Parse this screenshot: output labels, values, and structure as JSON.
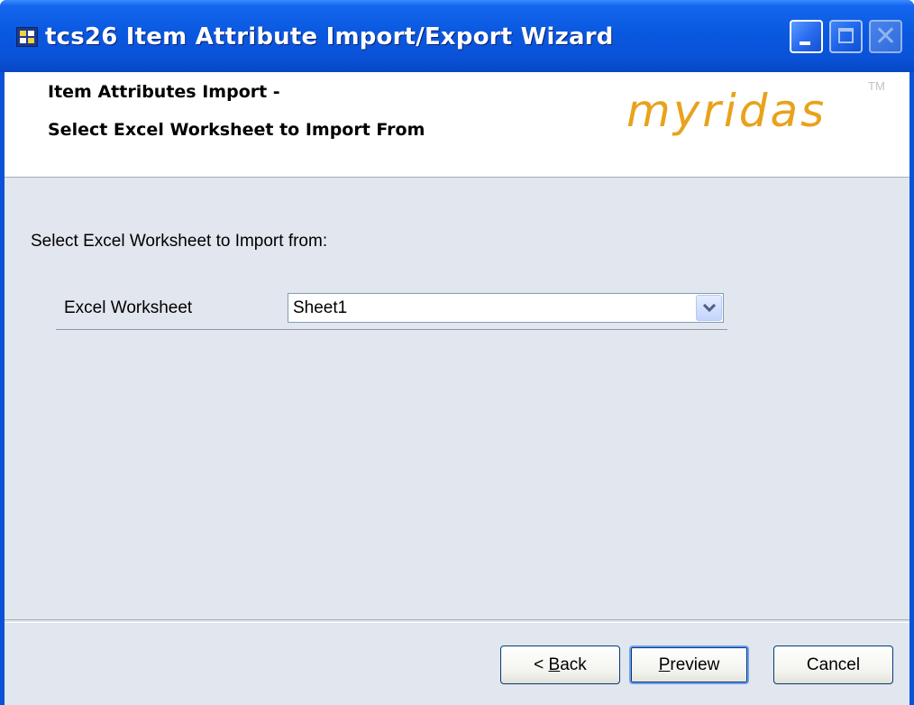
{
  "window": {
    "title": "tcs26 Item Attribute Import/Export Wizard",
    "app_icon": "app-icon",
    "controls": {
      "minimize_icon": "minimize-icon",
      "maximize_icon": "maximize-icon",
      "close_icon": "close-icon",
      "close_glyph": "✕"
    }
  },
  "header": {
    "line1": "Item Attributes Import -",
    "line2": "Select Excel Worksheet to Import From",
    "logo_text": "myridas",
    "logo_tm": "TM"
  },
  "body": {
    "instruction": "Select Excel Worksheet to Import from:",
    "field_label": "Excel Worksheet",
    "worksheet_value": "Sheet1",
    "dropdown_icon": "chevron-down-icon"
  },
  "buttons": {
    "back_prefix": "< ",
    "back_mnemonic": "B",
    "back_rest": "ack",
    "preview_mnemonic": "P",
    "preview_rest": "review",
    "cancel": "Cancel"
  },
  "colors": {
    "titlebar": "#0a58e0",
    "dialog_bg": "#e2e6ee",
    "logo": "#e8a21c"
  }
}
